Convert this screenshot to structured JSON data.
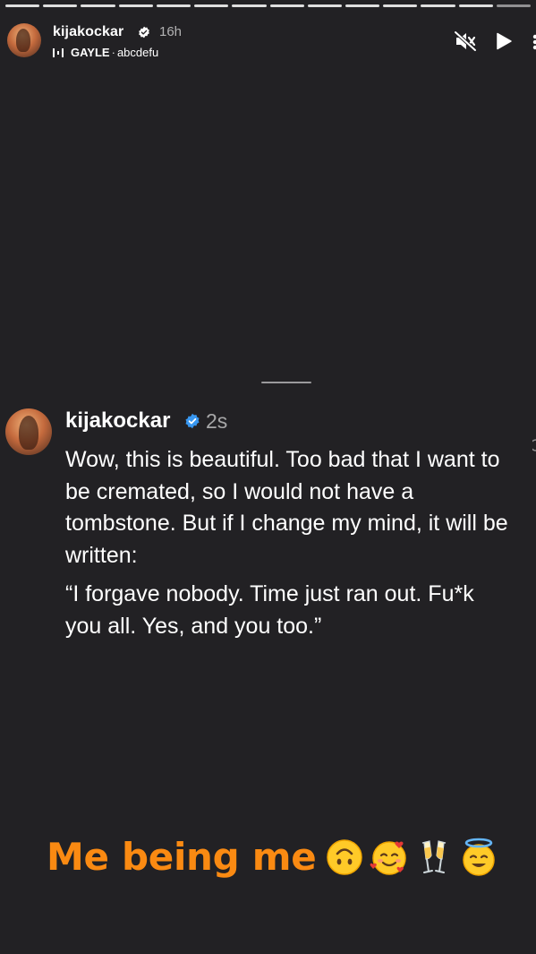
{
  "story": {
    "username": "kijakockar",
    "time": "16h",
    "music": {
      "artist": "GAYLE",
      "separator": "·",
      "song": "abcdefu"
    },
    "progress_segments": 14
  },
  "reply": {
    "username": "kijakockar",
    "time": "2s",
    "paragraph1": "Wow, this is beautiful. Too bad that I want to be cremated, so I would not have a tombstone. But if I change my mind, it will be written:",
    "paragraph2": "“I forgave nobody. Time just ran out. Fu*k you all. Yes, and you too.”"
  },
  "caption": {
    "text": "Me being me",
    "emojis": [
      "upside-down-face",
      "smiling-face-with-hearts",
      "clinking-glasses",
      "smiling-face-with-halo"
    ]
  },
  "colors": {
    "background": "#222124",
    "caption": "#fa8a12",
    "verified_blue": "#3897f0"
  }
}
